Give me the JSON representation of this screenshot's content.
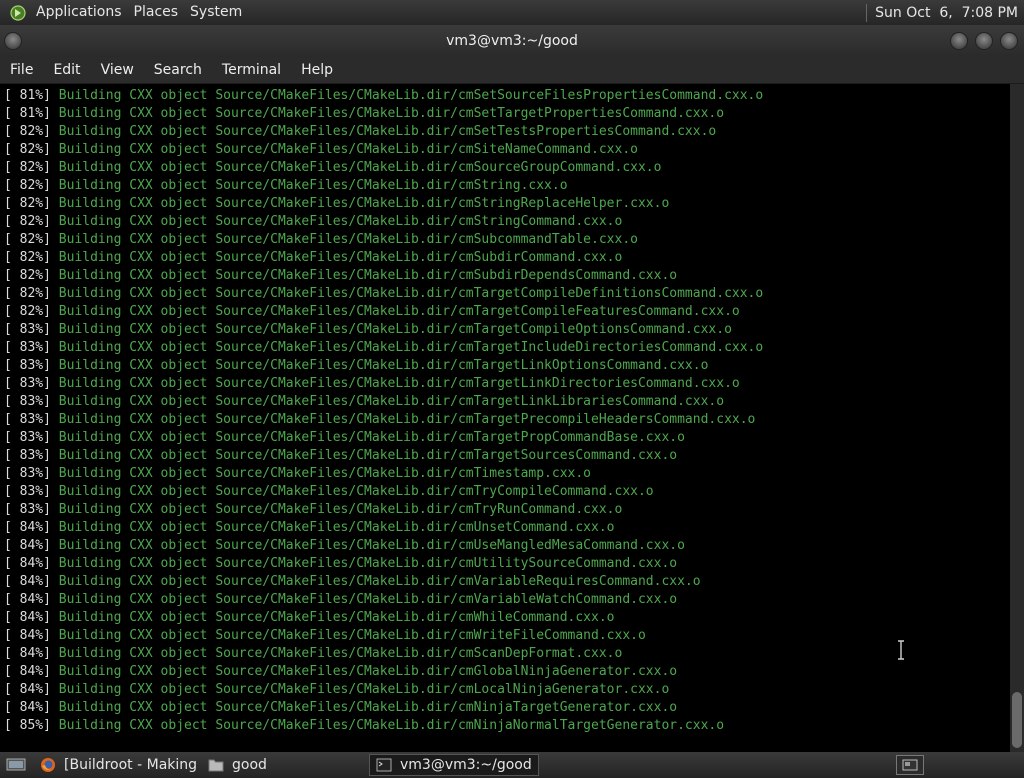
{
  "top_panel": {
    "menus": [
      "Applications",
      "Places",
      "System"
    ],
    "clock": "Sun Oct  6,  7:08 PM"
  },
  "window": {
    "title": "vm3@vm3:~/good",
    "menus": [
      "File",
      "Edit",
      "View",
      "Search",
      "Terminal",
      "Help"
    ]
  },
  "terminal": {
    "lines": [
      {
        "pct": "[ 81%]",
        "text": "Building CXX object Source/CMakeFiles/CMakeLib.dir/cmSetSourceFilesPropertiesCommand.cxx.o"
      },
      {
        "pct": "[ 81%]",
        "text": "Building CXX object Source/CMakeFiles/CMakeLib.dir/cmSetTargetPropertiesCommand.cxx.o"
      },
      {
        "pct": "[ 82%]",
        "text": "Building CXX object Source/CMakeFiles/CMakeLib.dir/cmSetTestsPropertiesCommand.cxx.o"
      },
      {
        "pct": "[ 82%]",
        "text": "Building CXX object Source/CMakeFiles/CMakeLib.dir/cmSiteNameCommand.cxx.o"
      },
      {
        "pct": "[ 82%]",
        "text": "Building CXX object Source/CMakeFiles/CMakeLib.dir/cmSourceGroupCommand.cxx.o"
      },
      {
        "pct": "[ 82%]",
        "text": "Building CXX object Source/CMakeFiles/CMakeLib.dir/cmString.cxx.o"
      },
      {
        "pct": "[ 82%]",
        "text": "Building CXX object Source/CMakeFiles/CMakeLib.dir/cmStringReplaceHelper.cxx.o"
      },
      {
        "pct": "[ 82%]",
        "text": "Building CXX object Source/CMakeFiles/CMakeLib.dir/cmStringCommand.cxx.o"
      },
      {
        "pct": "[ 82%]",
        "text": "Building CXX object Source/CMakeFiles/CMakeLib.dir/cmSubcommandTable.cxx.o"
      },
      {
        "pct": "[ 82%]",
        "text": "Building CXX object Source/CMakeFiles/CMakeLib.dir/cmSubdirCommand.cxx.o"
      },
      {
        "pct": "[ 82%]",
        "text": "Building CXX object Source/CMakeFiles/CMakeLib.dir/cmSubdirDependsCommand.cxx.o"
      },
      {
        "pct": "[ 82%]",
        "text": "Building CXX object Source/CMakeFiles/CMakeLib.dir/cmTargetCompileDefinitionsCommand.cxx.o"
      },
      {
        "pct": "[ 82%]",
        "text": "Building CXX object Source/CMakeFiles/CMakeLib.dir/cmTargetCompileFeaturesCommand.cxx.o"
      },
      {
        "pct": "[ 83%]",
        "text": "Building CXX object Source/CMakeFiles/CMakeLib.dir/cmTargetCompileOptionsCommand.cxx.o"
      },
      {
        "pct": "[ 83%]",
        "text": "Building CXX object Source/CMakeFiles/CMakeLib.dir/cmTargetIncludeDirectoriesCommand.cxx.o"
      },
      {
        "pct": "[ 83%]",
        "text": "Building CXX object Source/CMakeFiles/CMakeLib.dir/cmTargetLinkOptionsCommand.cxx.o"
      },
      {
        "pct": "[ 83%]",
        "text": "Building CXX object Source/CMakeFiles/CMakeLib.dir/cmTargetLinkDirectoriesCommand.cxx.o"
      },
      {
        "pct": "[ 83%]",
        "text": "Building CXX object Source/CMakeFiles/CMakeLib.dir/cmTargetLinkLibrariesCommand.cxx.o"
      },
      {
        "pct": "[ 83%]",
        "text": "Building CXX object Source/CMakeFiles/CMakeLib.dir/cmTargetPrecompileHeadersCommand.cxx.o"
      },
      {
        "pct": "[ 83%]",
        "text": "Building CXX object Source/CMakeFiles/CMakeLib.dir/cmTargetPropCommandBase.cxx.o"
      },
      {
        "pct": "[ 83%]",
        "text": "Building CXX object Source/CMakeFiles/CMakeLib.dir/cmTargetSourcesCommand.cxx.o"
      },
      {
        "pct": "[ 83%]",
        "text": "Building CXX object Source/CMakeFiles/CMakeLib.dir/cmTimestamp.cxx.o"
      },
      {
        "pct": "[ 83%]",
        "text": "Building CXX object Source/CMakeFiles/CMakeLib.dir/cmTryCompileCommand.cxx.o"
      },
      {
        "pct": "[ 83%]",
        "text": "Building CXX object Source/CMakeFiles/CMakeLib.dir/cmTryRunCommand.cxx.o"
      },
      {
        "pct": "[ 84%]",
        "text": "Building CXX object Source/CMakeFiles/CMakeLib.dir/cmUnsetCommand.cxx.o"
      },
      {
        "pct": "[ 84%]",
        "text": "Building CXX object Source/CMakeFiles/CMakeLib.dir/cmUseMangledMesaCommand.cxx.o"
      },
      {
        "pct": "[ 84%]",
        "text": "Building CXX object Source/CMakeFiles/CMakeLib.dir/cmUtilitySourceCommand.cxx.o"
      },
      {
        "pct": "[ 84%]",
        "text": "Building CXX object Source/CMakeFiles/CMakeLib.dir/cmVariableRequiresCommand.cxx.o"
      },
      {
        "pct": "[ 84%]",
        "text": "Building CXX object Source/CMakeFiles/CMakeLib.dir/cmVariableWatchCommand.cxx.o"
      },
      {
        "pct": "[ 84%]",
        "text": "Building CXX object Source/CMakeFiles/CMakeLib.dir/cmWhileCommand.cxx.o"
      },
      {
        "pct": "[ 84%]",
        "text": "Building CXX object Source/CMakeFiles/CMakeLib.dir/cmWriteFileCommand.cxx.o"
      },
      {
        "pct": "[ 84%]",
        "text": "Building CXX object Source/CMakeFiles/CMakeLib.dir/cmScanDepFormat.cxx.o"
      },
      {
        "pct": "[ 84%]",
        "text": "Building CXX object Source/CMakeFiles/CMakeLib.dir/cmGlobalNinjaGenerator.cxx.o"
      },
      {
        "pct": "[ 84%]",
        "text": "Building CXX object Source/CMakeFiles/CMakeLib.dir/cmLocalNinjaGenerator.cxx.o"
      },
      {
        "pct": "[ 84%]",
        "text": "Building CXX object Source/CMakeFiles/CMakeLib.dir/cmNinjaTargetGenerator.cxx.o"
      },
      {
        "pct": "[ 85%]",
        "text": "Building CXX object Source/CMakeFiles/CMakeLib.dir/cmNinjaNormalTargetGenerator.cxx.o"
      }
    ]
  },
  "taskbar": {
    "tasks": [
      {
        "label": "[Buildroot - Making ...",
        "icon": "firefox-icon"
      },
      {
        "label": "good",
        "icon": "folder-icon"
      },
      {
        "label": "vm3@vm3:~/good",
        "icon": "terminal-icon"
      }
    ]
  },
  "colors": {
    "terminal_bg": "#000000",
    "build_text": "#4ea74e",
    "percent_text": "#dcdcdc"
  }
}
